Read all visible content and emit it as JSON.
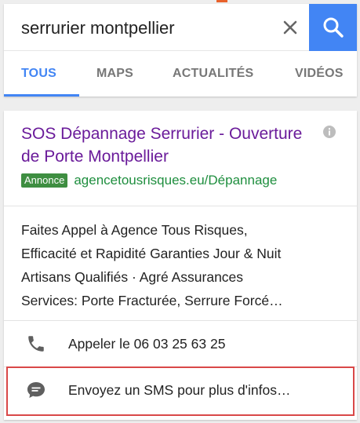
{
  "search": {
    "query": "serrurier montpellier"
  },
  "tabs": [
    {
      "label": "TOUS"
    },
    {
      "label": "MAPS"
    },
    {
      "label": "ACTUALITÉS"
    },
    {
      "label": "VIDÉOS"
    }
  ],
  "ad": {
    "title": "SOS Dépannage Serrurier - Ouverture de Porte Montpellier",
    "badge": "Annonce",
    "url": "agencetousrisques.eu/Dépannage",
    "description": [
      "Faites Appel à Agence Tous Risques,",
      "Efficacité et Rapidité Garanties Jour & Nuit",
      "Artisans Qualifiés · Agré Assurances",
      "Services: Porte Fracturée, Serrure Forcé…"
    ],
    "call_label": "Appeler le 06 03 25 63 25",
    "sms_label": "Envoyez un SMS pour plus d'infos…"
  },
  "colors": {
    "accent": "#4285f4",
    "title": "#6a1b9a",
    "url": "#1e8e3e",
    "badge": "#3e8e41",
    "highlight": "#d94848"
  },
  "icons": {
    "clear": "close-icon",
    "search": "search-icon",
    "info": "info-icon",
    "call": "phone-icon",
    "sms": "message-icon"
  }
}
